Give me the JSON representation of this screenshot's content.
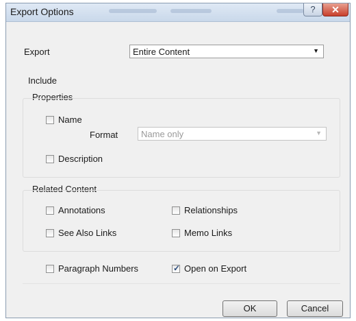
{
  "window": {
    "title": "Export Options",
    "help_glyph": "?",
    "close_glyph": "✕"
  },
  "export": {
    "label": "Export",
    "selected": "Entire Content",
    "dropdown_icon": "chevron-down-icon"
  },
  "include": {
    "label": "Include",
    "properties": {
      "label": "Properties",
      "name_checkbox": {
        "label": "Name",
        "checked": false
      },
      "format_label": "Format",
      "format_selected": "Name only",
      "description_checkbox": {
        "label": "Description",
        "checked": false
      }
    },
    "related": {
      "label": "Related Content",
      "annotations": {
        "label": "Annotations",
        "checked": false
      },
      "relationships": {
        "label": "Relationships",
        "checked": false
      },
      "see_also": {
        "label": "See Also Links",
        "checked": false
      },
      "memo_links": {
        "label": "Memo Links",
        "checked": false
      }
    },
    "paragraph_numbers": {
      "label": "Paragraph Numbers",
      "checked": false
    },
    "open_on_export": {
      "label": "Open on Export",
      "checked": true
    }
  },
  "buttons": {
    "ok": "OK",
    "cancel": "Cancel"
  }
}
